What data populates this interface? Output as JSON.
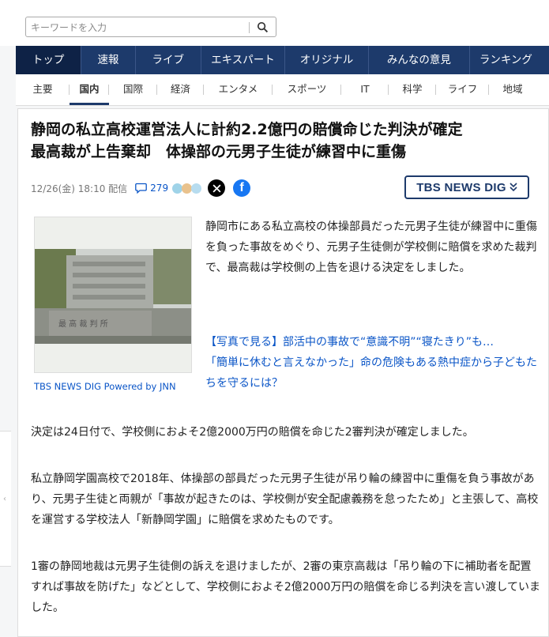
{
  "search": {
    "placeholder": "キーワードを入力"
  },
  "nav": [
    "トップ",
    "速報",
    "ライブ",
    "エキスパート",
    "オリジナル",
    "みんなの意見",
    "ランキング"
  ],
  "subnav": [
    "主要",
    "国内",
    "国際",
    "経済",
    "エンタメ",
    "スポーツ",
    "IT",
    "科学",
    "ライフ",
    "地域"
  ],
  "article": {
    "title_line1": "静岡の私立高校運営法人に計約2.2億円の賠償命じた判決が確定",
    "title_line2": "最高裁が上告棄却　体操部の元男子生徒が練習中に重傷",
    "date": "12/26(金) 18:10 配信",
    "comment_count": "279",
    "source_logo": "TBS NEWS DIG",
    "photo_caption": "TBS NEWS DIG Powered by JNN",
    "lead": "静岡市にある私立高校の体操部員だった元男子生徒が練習中に重傷を負った事故をめぐり、元男子生徒側が学校側に賠償を求めた裁判で、最高裁は学校側の上告を退ける決定をしました。",
    "link1": "【写真で見る】部活中の事故で“意識不明”“寝たきり”も…",
    "link2": "「簡単に休むと言えなかった」命の危険もある熱中症から子どもたちを守るには？",
    "para1": "決定は24日付で、学校側におよそ2億2000万円の賠償を命じた2審判決が確定しました。",
    "para2": "私立静岡学園高校で2018年、体操部の部員だった元男子生徒が吊り輪の練習中に重傷を負う事故があり、元男子生徒と両親が「事故が起きたのは、学校側が安全配慮義務を怠ったため」と主張して、高校を運営する学校法人「新静岡学園」に賠償を求めたものです。",
    "para3": "1審の静岡地裁は元男子生徒側の訴えを退けましたが、2審の東京高裁は「吊り輪の下に補助者を配置すれば事故を防げた」などとして、学校側におよそ2億2000万円の賠償を命じる判決を言い渡していました。"
  },
  "colors": {
    "nav_bg": "#1d3a6b",
    "link": "#0a55c7",
    "x_brand": "#000000",
    "facebook_brand": "#1877f2"
  },
  "icons": [
    "search-icon",
    "comment-icon",
    "x-logo-icon",
    "facebook-icon",
    "chevron-down-icon"
  ]
}
